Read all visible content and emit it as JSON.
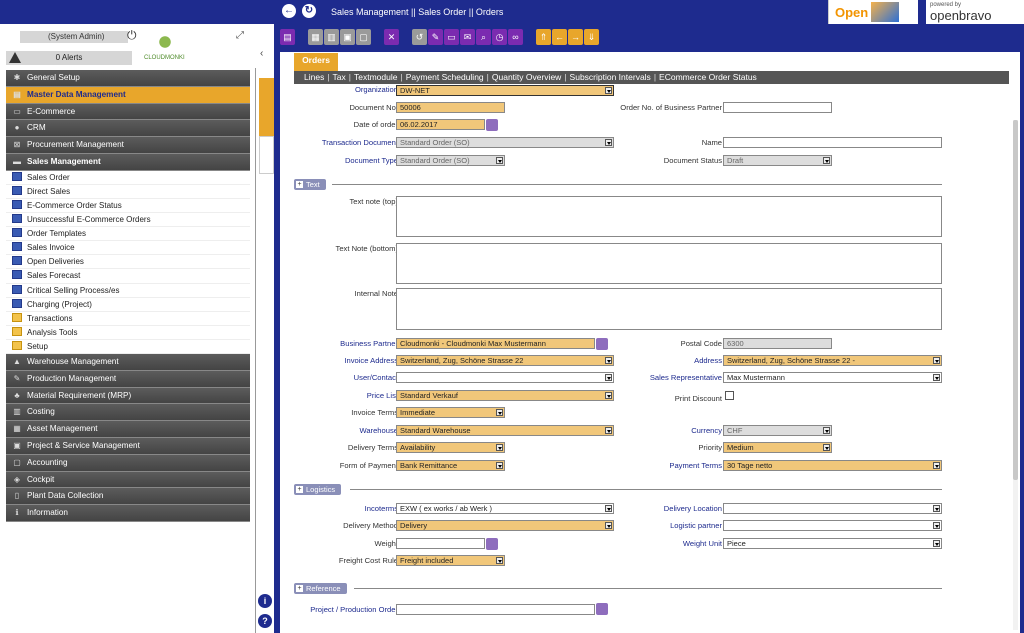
{
  "topbar": {
    "breadcrumb": "Sales Management || Sales Order || Orders",
    "logo_ob3": "Open",
    "logo_pb_small": "powered by",
    "logo_pb_big": "openbravo"
  },
  "user": {
    "name": "(System Admin)",
    "alerts": "0 Alerts",
    "logo_text": "CLOUDMONKI"
  },
  "menu": [
    {
      "label": "General Setup",
      "icon": "gear-icon",
      "glyph": "✱",
      "state": "closed"
    },
    {
      "label": "Master Data Management",
      "icon": "table-icon",
      "glyph": "▤",
      "state": "active"
    },
    {
      "label": "E-Commerce",
      "icon": "card-icon",
      "glyph": "▭",
      "state": "closed"
    },
    {
      "label": "CRM",
      "icon": "chat-icon",
      "glyph": "●",
      "state": "closed"
    },
    {
      "label": "Procurement Management",
      "icon": "cart-icon",
      "glyph": "⊠",
      "state": "closed"
    },
    {
      "label": "Sales Management",
      "icon": "truck-icon",
      "glyph": "▬",
      "state": "open",
      "children": [
        {
          "label": "Sales Order",
          "type": "window"
        },
        {
          "label": "Direct Sales",
          "type": "window"
        },
        {
          "label": "E-Commerce Order Status",
          "type": "window"
        },
        {
          "label": "Unsuccessful E-Commerce Orders",
          "type": "window"
        },
        {
          "label": "Order Templates",
          "type": "window"
        },
        {
          "label": "Sales Invoice",
          "type": "window"
        },
        {
          "label": "Open Deliveries",
          "type": "window"
        },
        {
          "label": "Sales Forecast",
          "type": "window"
        },
        {
          "label": "Critical Selling Process/es",
          "type": "window"
        },
        {
          "label": "Charging (Project)",
          "type": "window"
        },
        {
          "label": "Transactions",
          "type": "folder"
        },
        {
          "label": "Analysis Tools",
          "type": "folder"
        },
        {
          "label": "Setup",
          "type": "folder"
        }
      ]
    },
    {
      "label": "Warehouse Management",
      "icon": "warehouse-icon",
      "glyph": "▲",
      "state": "closed"
    },
    {
      "label": "Production Management",
      "icon": "wrench-icon",
      "glyph": "✎",
      "state": "closed"
    },
    {
      "label": "Material Requirement (MRP)",
      "icon": "sitemap-icon",
      "glyph": "♣",
      "state": "closed"
    },
    {
      "label": "Costing",
      "icon": "chart-icon",
      "glyph": "▥",
      "state": "closed"
    },
    {
      "label": "Asset Management",
      "icon": "barcode-icon",
      "glyph": "▦",
      "state": "closed"
    },
    {
      "label": "Project & Service Management",
      "icon": "briefcase-icon",
      "glyph": "▣",
      "state": "closed"
    },
    {
      "label": "Accounting",
      "icon": "money-icon",
      "glyph": "▢",
      "state": "closed"
    },
    {
      "label": "Cockpit",
      "icon": "dashboard-icon",
      "glyph": "◈",
      "state": "closed"
    },
    {
      "label": "Plant Data Collection",
      "icon": "building-icon",
      "glyph": "▯",
      "state": "closed"
    },
    {
      "label": "Information",
      "icon": "info-icon",
      "glyph": "ℹ",
      "state": "closed"
    }
  ],
  "tab": {
    "label": "Orders"
  },
  "subtabs": [
    "Lines",
    "Tax",
    "Textmodule",
    "Payment Scheduling",
    "Quantity Overview",
    "Subscription Intervals",
    "ECommerce Order Status"
  ],
  "form": {
    "organization": {
      "label": "Organization",
      "value": "DW-NET"
    },
    "document_no": {
      "label": "Document No.",
      "value": "50006"
    },
    "order_no_bp": {
      "label": "Order No. of Business Partner",
      "value": ""
    },
    "date_of_order": {
      "label": "Date of order",
      "value": "06.02.2017"
    },
    "transaction_document": {
      "label": "Transaction Document",
      "value": "Standard Order (SO)"
    },
    "name": {
      "label": "Name",
      "value": ""
    },
    "document_type": {
      "label": "Document Type",
      "value": "Standard Order (SO)"
    },
    "document_status": {
      "label": "Document Status",
      "value": "Draft"
    },
    "section_text": "Text",
    "text_note_top": {
      "label": "Text note (top)",
      "value": ""
    },
    "text_note_bottom": {
      "label": "Text Note (bottom)",
      "value": ""
    },
    "internal_note": {
      "label": "Internal Note",
      "value": ""
    },
    "business_partner": {
      "label": "Business Partner",
      "value": "Cloudmonki - Cloudmonki Max Mustermann"
    },
    "postal_code": {
      "label": "Postal Code",
      "value": "6300"
    },
    "invoice_address": {
      "label": "Invoice Address",
      "value": "Switzerland, Zug, Schöne Strasse 22"
    },
    "address": {
      "label": "Address",
      "value": "Switzerland, Zug, Schöne Strasse 22 -"
    },
    "user_contact": {
      "label": "User/Contact",
      "value": ""
    },
    "sales_rep": {
      "label": "Sales Representative",
      "value": "Max Mustermann"
    },
    "price_list": {
      "label": "Price List",
      "value": "Standard Verkauf"
    },
    "print_discount": {
      "label": "Print Discount",
      "checked": false
    },
    "invoice_terms": {
      "label": "Invoice Terms",
      "value": "Immediate"
    },
    "warehouse": {
      "label": "Warehouse",
      "value": "Standard Warehouse"
    },
    "currency": {
      "label": "Currency",
      "value": "CHF"
    },
    "delivery_terms": {
      "label": "Delivery Terms",
      "value": "Availability"
    },
    "priority": {
      "label": "Priority",
      "value": "Medium"
    },
    "form_of_payment": {
      "label": "Form of Payment",
      "value": "Bank Remittance"
    },
    "payment_terms": {
      "label": "Payment Terms",
      "value": "30 Tage netto"
    },
    "section_logistics": "Logistics",
    "incoterms": {
      "label": "Incoterms",
      "value": "EXW ( ex works / ab Werk )"
    },
    "delivery_location": {
      "label": "Delivery Location",
      "value": ""
    },
    "delivery_method": {
      "label": "Delivery Method",
      "value": "Delivery"
    },
    "logistic_partner": {
      "label": "Logistic partner",
      "value": ""
    },
    "weight": {
      "label": "Weight",
      "value": ""
    },
    "weight_unit": {
      "label": "Weight Unit",
      "value": "Piece"
    },
    "freight_cost_rule": {
      "label": "Freight Cost Rule",
      "value": "Freight included"
    },
    "section_reference": "Reference",
    "project": {
      "label": "Project / Production Order",
      "value": ""
    }
  },
  "colors": {
    "topbar": "#1e2b8e",
    "accent": "#e8a62b",
    "toolbar_purple": "#7b2bb0",
    "menu_dark": "#4f4f4f"
  }
}
